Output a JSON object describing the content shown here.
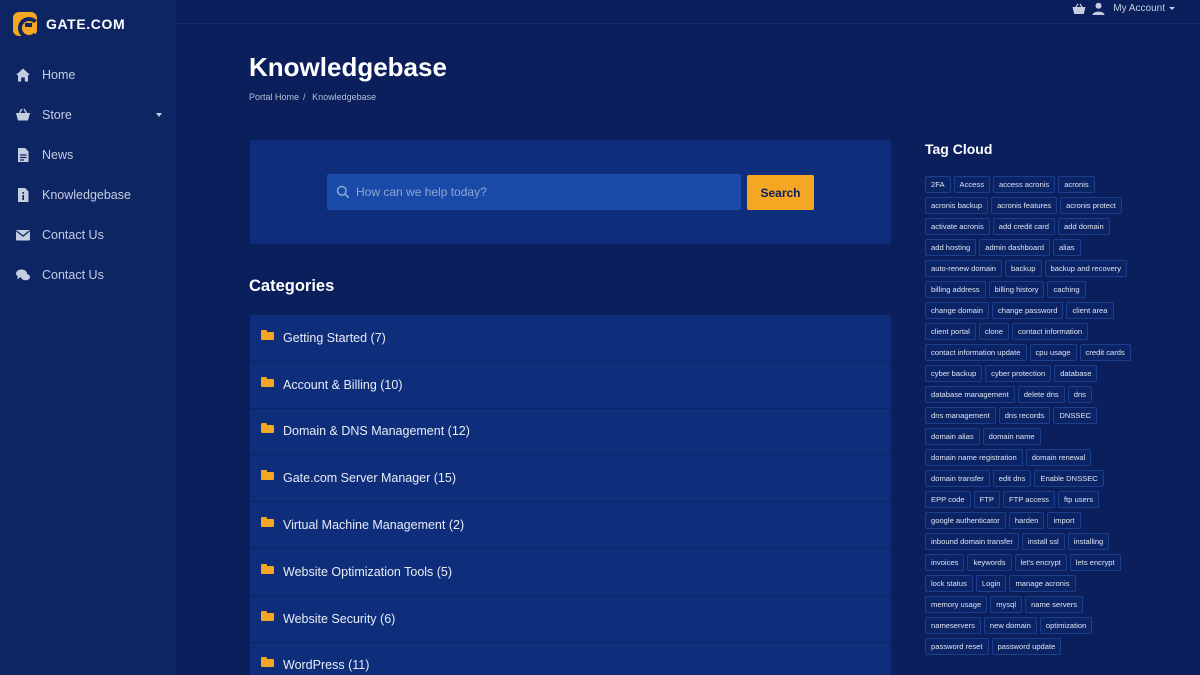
{
  "brand": {
    "name": "GATE.COM",
    "accent": "#f5a623",
    "background": "#0a1f5c",
    "sidebar_bg": "#0d2663",
    "panel_bg": "#0e2e7c"
  },
  "sidebar": {
    "items": [
      {
        "label": "Home",
        "icon": "home-icon"
      },
      {
        "label": "Store",
        "icon": "basket-icon",
        "dropdown": true
      },
      {
        "label": "News",
        "icon": "document-icon"
      },
      {
        "label": "Knowledgebase",
        "icon": "info-document-icon"
      },
      {
        "label": "Contact Us",
        "icon": "envelope-icon"
      },
      {
        "label": "Contact Us",
        "icon": "chat-bubbles-icon"
      }
    ]
  },
  "topbar": {
    "account_label": "My Account"
  },
  "page": {
    "title": "Knowledgebase",
    "breadcrumb": [
      "Portal Home",
      "Knowledgebase"
    ]
  },
  "search": {
    "placeholder": "How can we help today?",
    "button_label": "Search"
  },
  "categories": {
    "heading": "Categories",
    "items": [
      "Getting Started (7)",
      "Account & Billing (10)",
      "Domain & DNS Management (12)",
      "Gate.com Server Manager (15)",
      "Virtual Machine Management (2)",
      "Website Optimization Tools (5)",
      "Website Security (6)",
      "WordPress (11)"
    ]
  },
  "tag_cloud": {
    "heading": "Tag Cloud",
    "tags": [
      "2FA",
      "Access",
      "access acronis",
      "acronis",
      "acronis backup",
      "acronis features",
      "acronis protect",
      "activate acronis",
      "add credit card",
      "add domain",
      "add hosting",
      "admin dashboard",
      "alias",
      "auto-renew domain",
      "backup",
      "backup and recovery",
      "billing address",
      "billing history",
      "caching",
      "change domain",
      "change password",
      "client area",
      "client portal",
      "clone",
      "contact information",
      "contact information update",
      "cpu usage",
      "credit cards",
      "cyber backup",
      "cyber protection",
      "database",
      "database management",
      "delete dns",
      "dns",
      "dns management",
      "dns records",
      "DNSSEC",
      "domain alias",
      "domain name",
      "domain name registration",
      "domain renewal",
      "domain transfer",
      "edit dns",
      "Enable DNSSEC",
      "EPP code",
      "FTP",
      "FTP access",
      "ftp users",
      "google authenticator",
      "harden",
      "import",
      "inbound domain transfer",
      "install ssl",
      "installing",
      "invoices",
      "keywords",
      "let's encrypt",
      "lets encrypt",
      "lock status",
      "Login",
      "manage acronis",
      "memory usage",
      "mysql",
      "name servers",
      "nameservers",
      "new domain",
      "optimization",
      "password reset",
      "password update"
    ]
  }
}
